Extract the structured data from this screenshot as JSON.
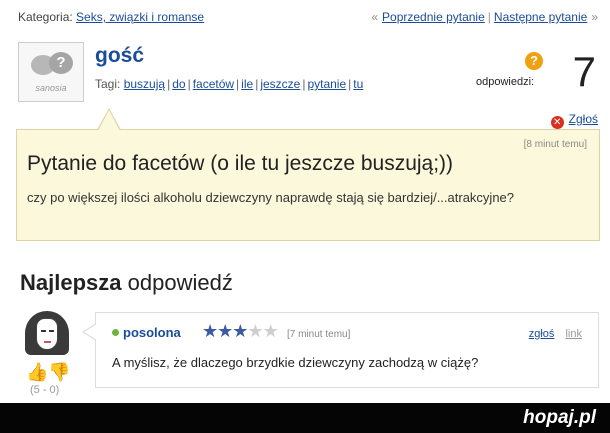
{
  "topbar": {
    "category_label": "Kategoria:",
    "category_value": "Seks, związki i romanse",
    "prev_arrow": "«",
    "prev_link": "Poprzednie pytanie",
    "separator": "|",
    "next_link": "Następne pytanie",
    "next_arrow": "»"
  },
  "asker": {
    "avatar_mark": "?",
    "avatar_brand": "sanosia",
    "name": "gość"
  },
  "tags": {
    "label": "Tagi:",
    "items": [
      "buszują",
      "do",
      "facetów",
      "ile",
      "jeszcze",
      "pytanie",
      "tu"
    ]
  },
  "answers_count": {
    "icon_mark": "?",
    "label": "odpowiedzi:",
    "value": "7"
  },
  "report": {
    "icon": "close-icon",
    "label": "Zgłoś"
  },
  "question": {
    "time": "[8 minut temu]",
    "title": "Pytanie do facetów (o ile tu jeszcze buszują;))",
    "body": "czy po większej ilości alkoholu dziewczyny naprawdę stają się bardziej/...atrakcyjne?"
  },
  "best_answer": {
    "heading_bold": "Najlepsza",
    "heading_rest": "odpowiedź",
    "author": "posolona",
    "rating": 3,
    "rating_max": 5,
    "time": "[7 minut temu]",
    "report_label": "zgłoś",
    "link_label": "link",
    "text": "A myślisz, że dlaczego brzydkie dziewczyny zachodzą w ciążę?",
    "votes": "(5 - 0)"
  },
  "footer": {
    "logo": "hopaj.pl"
  },
  "colors": {
    "link": "#1a4d99",
    "question_bg": "#fcf8db",
    "star_on": "#3b5aa0",
    "report_icon": "#d83020",
    "count_badge": "#f0a010"
  }
}
